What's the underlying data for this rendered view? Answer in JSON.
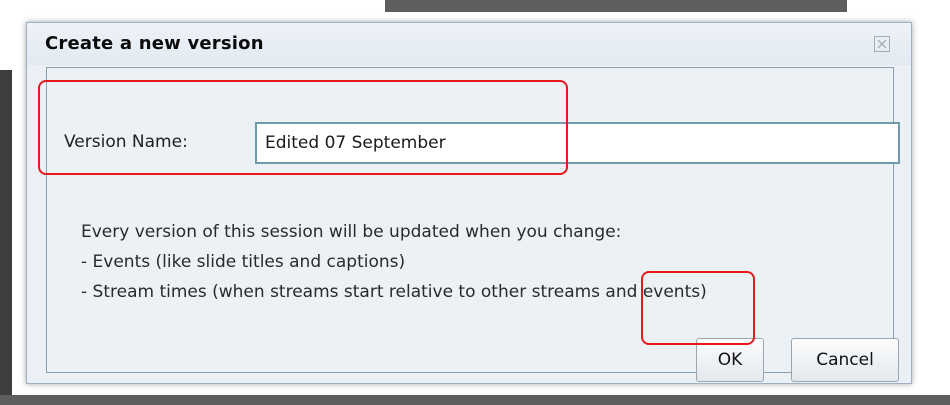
{
  "dialog": {
    "title": "Create a new version",
    "close_icon": "close-icon"
  },
  "form": {
    "version_name_label": "Version Name:",
    "version_name_value": "Edited 07 September"
  },
  "info": {
    "line1": "Every version of this session will be updated when you change:",
    "line2": "- Events (like slide titles and captions)",
    "line3": "- Stream times (when streams start relative to other streams and events)"
  },
  "buttons": {
    "ok": "OK",
    "cancel": "Cancel"
  },
  "colors": {
    "highlight": "#e8191e",
    "dialog_bg": "#eaf0f6",
    "input_border": "#6f9aa8"
  }
}
